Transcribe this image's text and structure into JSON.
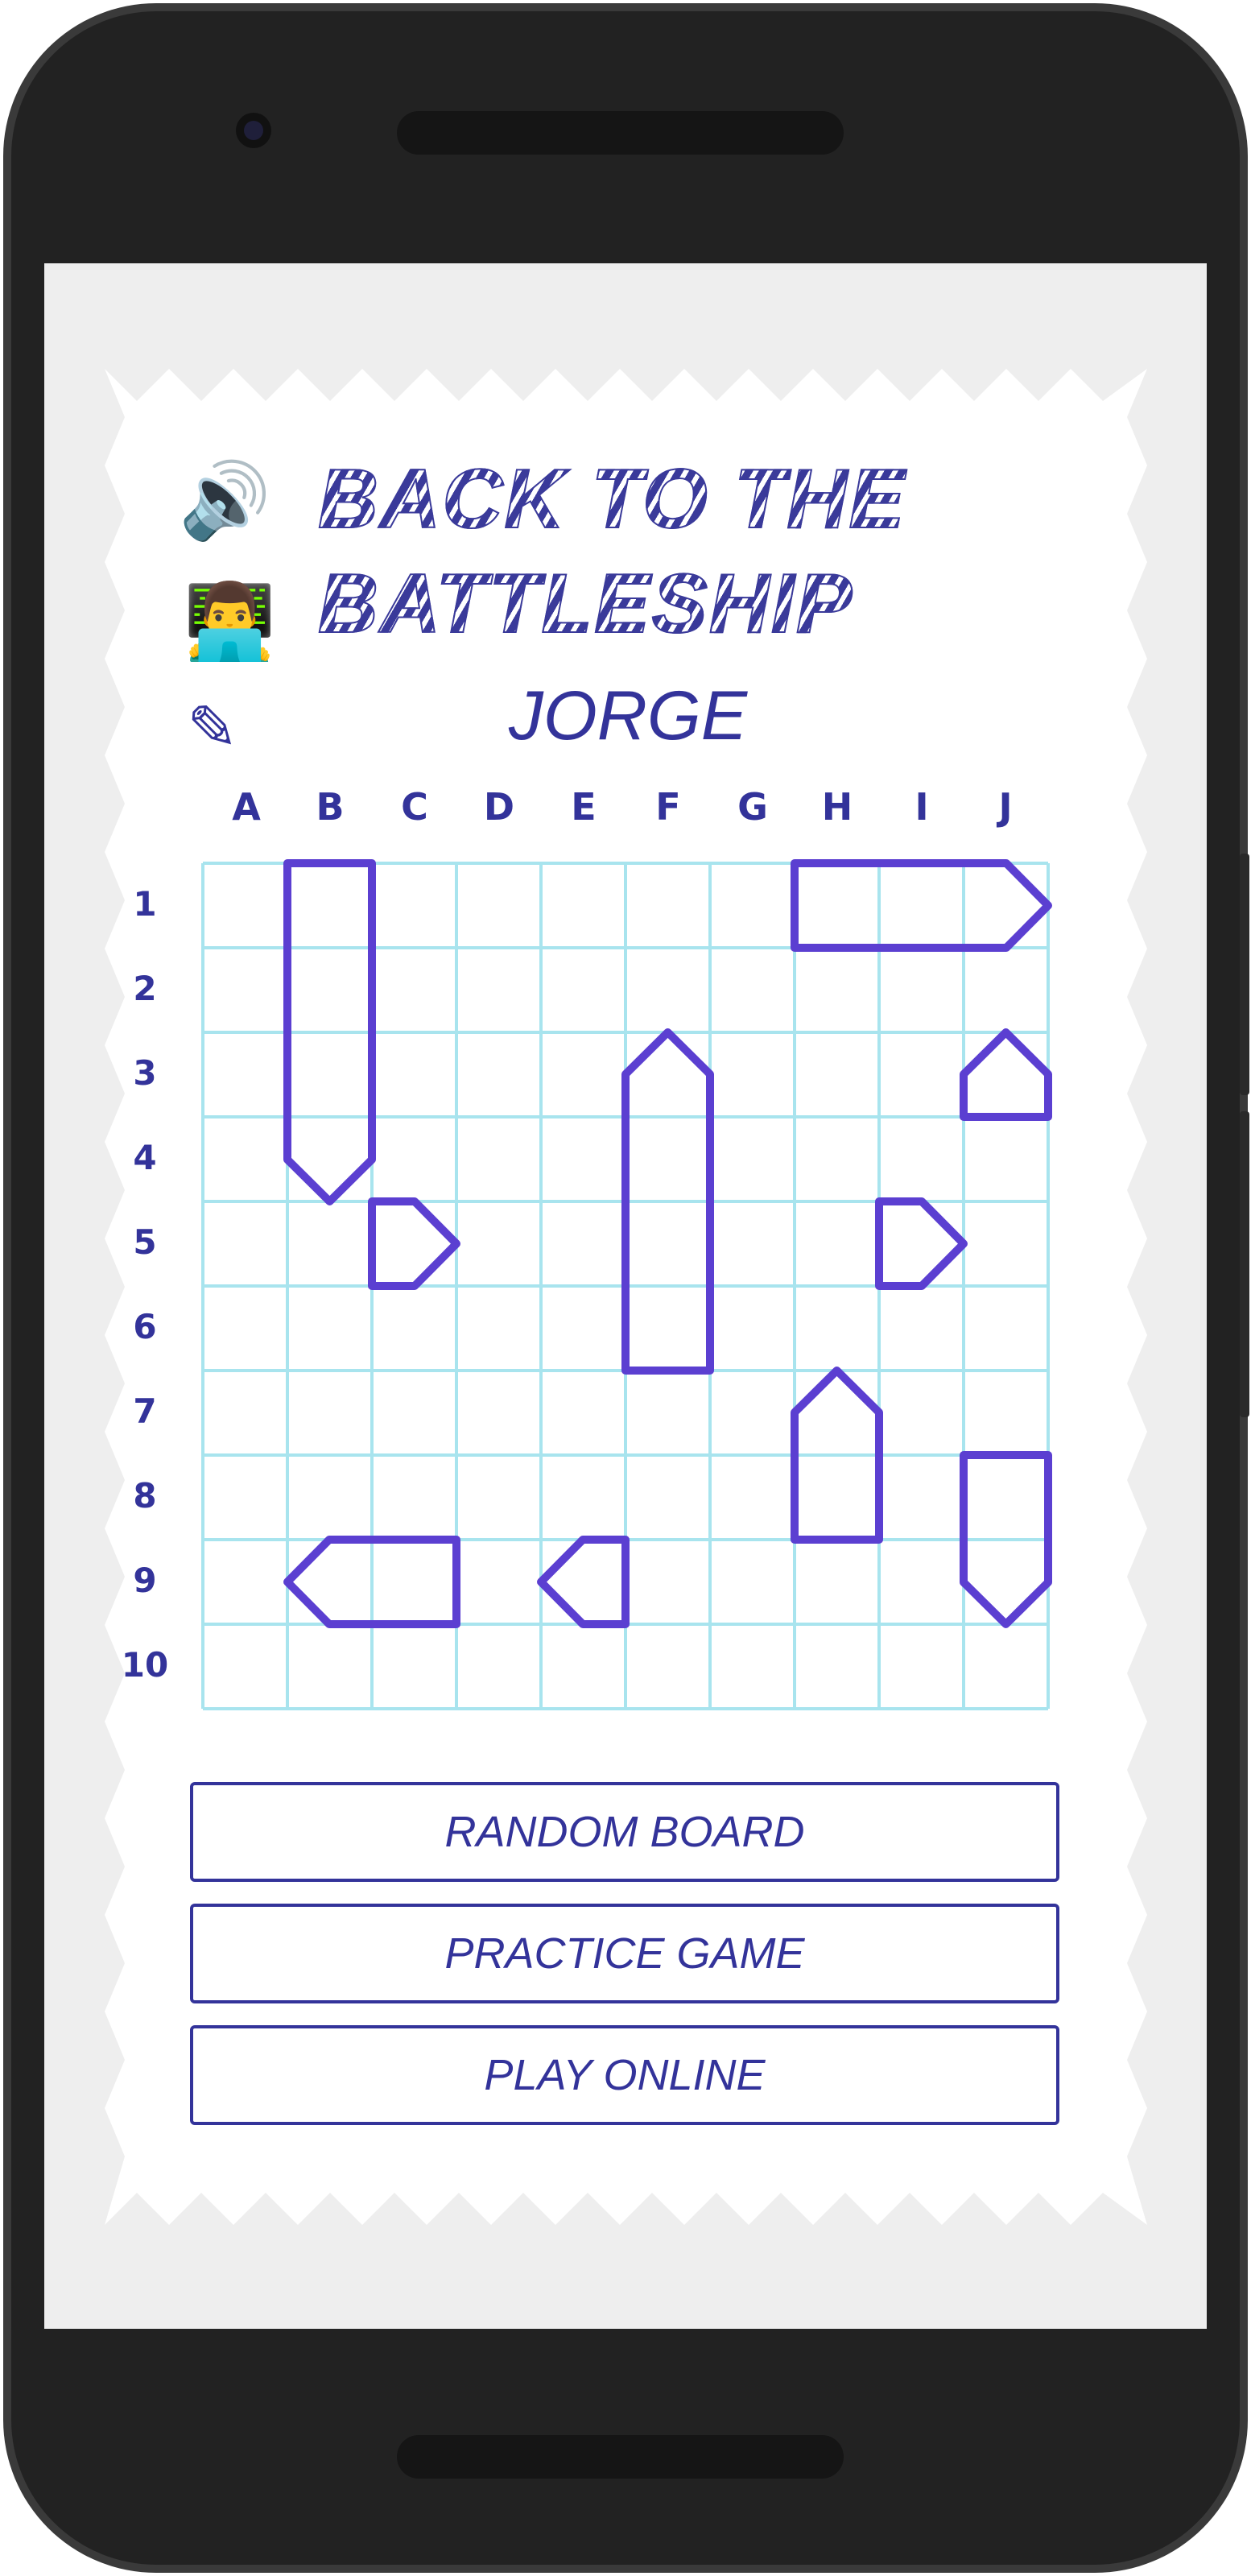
{
  "app": {
    "title_line1": "BACK TO THE",
    "title_line2": "BATTLESHIP",
    "player_name": "JORGE"
  },
  "icons": {
    "sound": "speaker-icon",
    "sound_glyph": "🔊",
    "profile": "technologist-icon",
    "profile_glyph": "👨‍💻",
    "edit": "pencil-icon",
    "edit_glyph": "✎"
  },
  "board": {
    "columns": [
      "A",
      "B",
      "C",
      "D",
      "E",
      "F",
      "G",
      "H",
      "I",
      "J"
    ],
    "rows": [
      "1",
      "2",
      "3",
      "4",
      "5",
      "6",
      "7",
      "8",
      "9",
      "10"
    ],
    "grid_color": "#a8e4ee",
    "ship_color": "#5b3fd1",
    "ships": [
      {
        "start": "B1",
        "length": 4,
        "orientation": "vertical",
        "bow": "down"
      },
      {
        "start": "H1",
        "length": 3,
        "orientation": "horizontal",
        "bow": "right"
      },
      {
        "start": "F3",
        "length": 4,
        "orientation": "vertical",
        "bow": "up"
      },
      {
        "start": "J3",
        "length": 1,
        "orientation": "single",
        "bow": "up"
      },
      {
        "start": "C5",
        "length": 1,
        "orientation": "single",
        "bow": "right"
      },
      {
        "start": "I5",
        "length": 1,
        "orientation": "single",
        "bow": "right"
      },
      {
        "start": "H7",
        "length": 2,
        "orientation": "vertical",
        "bow": "up"
      },
      {
        "start": "J8",
        "length": 2,
        "orientation": "vertical",
        "bow": "down"
      },
      {
        "start": "B9",
        "length": 2,
        "orientation": "horizontal",
        "bow": "left"
      },
      {
        "start": "E9",
        "length": 1,
        "orientation": "single",
        "bow": "left"
      }
    ]
  },
  "buttons": {
    "random_board": "RANDOM BOARD",
    "practice_game": "PRACTICE GAME",
    "play_online": "PLAY ONLINE"
  },
  "colors": {
    "text": "#33339a",
    "phone_body": "#232323",
    "screen_bg": "#eeeeee"
  }
}
